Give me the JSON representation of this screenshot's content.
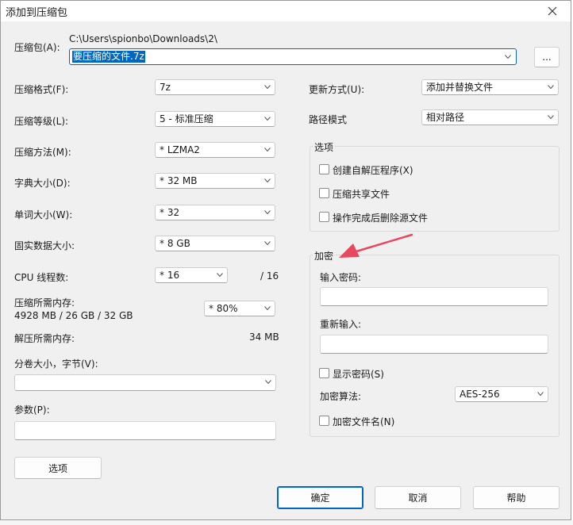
{
  "window": {
    "title": "添加到压缩包"
  },
  "archive": {
    "label": "压缩包(A):",
    "directory": "C:\\Users\\spionbo\\Downloads\\2\\",
    "filename": "要压缩的文件.7z",
    "browse_label": "..."
  },
  "left": {
    "format": {
      "label": "压缩格式(F):",
      "value": "7z"
    },
    "level": {
      "label": "压缩等级(L):",
      "value": "5 - 标准压缩"
    },
    "method": {
      "label": "压缩方法(M):",
      "value": "* LZMA2"
    },
    "dict": {
      "label": "字典大小(D):",
      "value": "* 32 MB"
    },
    "word": {
      "label": "单词大小(W):",
      "value": "* 32"
    },
    "solid": {
      "label": "固实数据大小:",
      "value": "* 8 GB"
    },
    "threads": {
      "label": "CPU 线程数:",
      "value": "* 16",
      "total": "/ 16"
    },
    "memory": {
      "label": "压缩所需内存:",
      "detail": "4928 MB / 26 GB / 32 GB",
      "value": "* 80%"
    },
    "decompress_memory": {
      "label": "解压所需内存:",
      "value": "34 MB"
    },
    "volume": {
      "label": "分卷大小，字节(V):",
      "value": ""
    },
    "params": {
      "label": "参数(P):",
      "value": ""
    },
    "options_button": "选项"
  },
  "right": {
    "update": {
      "label": "更新方式(U):",
      "value": "添加并替换文件"
    },
    "path_mode": {
      "label": "路径模式",
      "value": "相对路径"
    },
    "options_group": {
      "title": "选项",
      "sfx": "创建自解压程序(X)",
      "shared": "压缩共享文件",
      "delete": "操作完成后删除源文件"
    },
    "encryption": {
      "title": "加密",
      "password_label": "输入密码:",
      "reenter_label": "重新输入:",
      "show_password": "显示密码(S)",
      "method_label": "加密算法:",
      "method_value": "AES-256",
      "encrypt_names": "加密文件名(N)"
    }
  },
  "buttons": {
    "ok": "确定",
    "cancel": "取消",
    "help": "帮助"
  },
  "colors": {
    "accent": "#0067c0",
    "arrow": "#e8475f",
    "dialog_bg": "#f0f0f0"
  },
  "icons": [
    "close-icon",
    "chevron-down-icon",
    "annotation-arrow"
  ]
}
